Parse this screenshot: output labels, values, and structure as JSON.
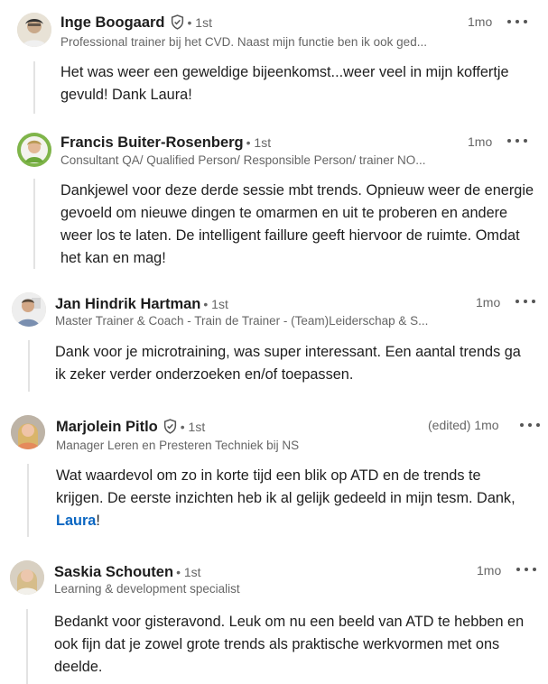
{
  "comments": [
    {
      "name": "Inge Boogaard",
      "verified": true,
      "degree": "• 1st",
      "headline": "Professional trainer bij het CVD. Naast mijn functie ben ik ook ged...",
      "time": "1mo",
      "text": "Het was weer een geweldige bijeenkomst...weer veel in mijn koffertje gevuld! Dank Laura!"
    },
    {
      "name": "Francis Buiter-Rosenberg",
      "verified": false,
      "degree": "• 1st",
      "headline": "Consultant QA/ Qualified Person/ Responsible Person/ trainer NO...",
      "time": "1mo",
      "text": "Dankjewel voor deze derde sessie mbt trends. Opnieuw weer de energie gevoeld om nieuwe dingen te omarmen en uit te proberen en andere weer los te laten. De intelligent faillure geeft hiervoor de ruimte. Omdat het kan en mag!"
    },
    {
      "name": "Jan Hindrik Hartman",
      "verified": false,
      "degree": "• 1st",
      "headline": "Master Trainer & Coach - Train de Trainer - (Team)Leiderschap & S...",
      "time": "1mo",
      "text": "Dank voor je microtraining, was super interessant. Een aantal trends ga ik zeker verder onderzoeken en/of toepassen."
    },
    {
      "name": "Marjolein Pitlo",
      "verified": true,
      "degree": "• 1st",
      "headline": "Manager Leren en Presteren Techniek bij NS",
      "time": "(edited) 1mo",
      "text_before": "Wat waardevol om zo in korte tijd een blik op ATD en de trends te krijgen. De eerste inzichten heb ik al gelijk gedeeld in mijn tesm. Dank, ",
      "mention": "Laura",
      "text_after": "!"
    },
    {
      "name": "Saskia Schouten",
      "verified": false,
      "degree": "• 1st",
      "headline": "Learning & development specialist",
      "time": "1mo",
      "text": "Bedankt voor gisteravond. Leuk om nu een beeld van ATD te hebben en ook fijn dat je zowel grote trends als praktische werkvormen met ons deelde."
    }
  ],
  "colors": {
    "mention": "#0a66c2",
    "thread_line": "#e3e3e3"
  },
  "icons": {
    "verified": "verified-shield-icon",
    "more": "more-options-icon"
  }
}
